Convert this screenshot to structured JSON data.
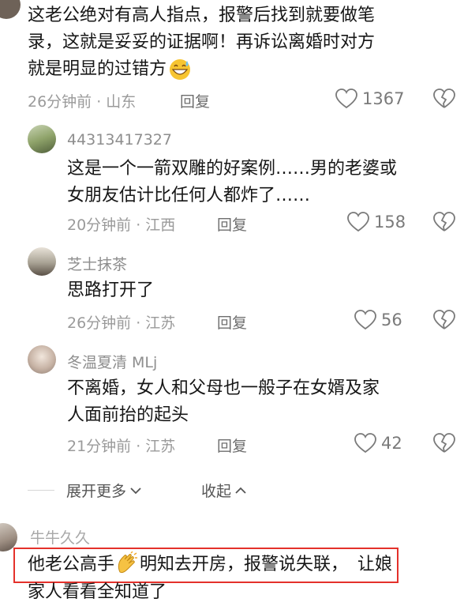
{
  "comments": [
    {
      "lines": [
        "这老公绝对有高人指点，报警后找到就要做笔",
        "录，这就是妥妥的证据啊！再诉讼离婚时对方",
        "就是明显的过错方"
      ],
      "time": "26分钟前 · 山东",
      "reply": "回复",
      "likes": "1367"
    },
    {
      "user": "44313417327",
      "lines": [
        "这是一个一箭双雕的好案例……男的老婆或",
        "女朋友估计比任何人都炸了……"
      ],
      "time": "20分钟前 · 江西",
      "reply": "回复",
      "likes": "158"
    },
    {
      "user": "芝士抹茶",
      "lines": [
        "思路打开了"
      ],
      "time": "26分钟前 · 江苏",
      "reply": "回复",
      "likes": "56"
    },
    {
      "user": "冬温夏清 MLj",
      "lines": [
        "不离婚，女人和父母也一般子在女婿及家",
        "人面前抬的起头"
      ],
      "time": "21分钟前 · 江苏",
      "reply": "回复",
      "likes": "42"
    }
  ],
  "thread_actions": {
    "expand": "展开更多",
    "collapse": "收起"
  },
  "last_comment": {
    "user": "牛牛久久",
    "line1_a": "他老公高手",
    "line1_b": "明知去开房，报警说失联，",
    "line1_c": "让娘",
    "line2": "家人看看全知道了"
  },
  "icons": {
    "like": "heart-outline-icon",
    "dislike": "broken-heart-icon",
    "emoji_grin": "grinning-sweat-emoji",
    "emoji_clap": "clapping-hands-emoji"
  },
  "colors": {
    "highlight": "#e4312b"
  }
}
